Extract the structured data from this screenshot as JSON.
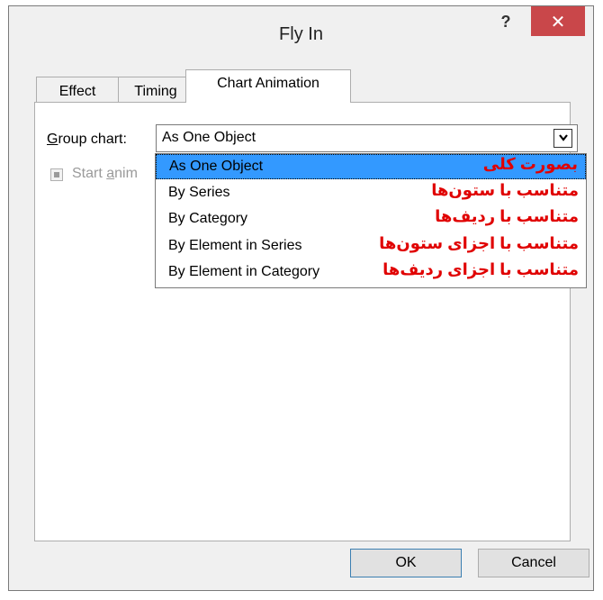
{
  "window": {
    "title": "Fly In",
    "help": "?",
    "close": "✕"
  },
  "tabs": [
    {
      "label": "Effect",
      "selected": false
    },
    {
      "label": "Timing",
      "selected": false
    },
    {
      "label": "Chart Animation",
      "selected": true
    }
  ],
  "group_chart": {
    "label_accel": "G",
    "label_rest": "roup chart:",
    "value": "As One Object",
    "arrow_icon": "chevron-down-icon"
  },
  "start_animation": {
    "label_start": "Start ",
    "label_accel": "a",
    "label_rest": "nim",
    "checked": true,
    "disabled": true
  },
  "dropdown": {
    "options": [
      {
        "label": "As One Object",
        "annotation": "بصورت کلی",
        "highlighted": true
      },
      {
        "label": "By Series",
        "annotation": "متناسب با ستون‌ها",
        "highlighted": false
      },
      {
        "label": "By Category",
        "annotation": "متناسب با ردیف‌ها",
        "highlighted": false
      },
      {
        "label": "By Element in Series",
        "annotation": "متناسب با اجزای ستون‌ها",
        "highlighted": false
      },
      {
        "label": "By Element in Category",
        "annotation": "متناسب با اجزای ردیف‌ها",
        "highlighted": false
      }
    ]
  },
  "buttons": {
    "ok": "OK",
    "cancel": "Cancel"
  },
  "colors": {
    "highlight": "#3399ff",
    "annotation": "#e00000",
    "close_button": "#c9474a",
    "dialog_bg": "#f0f0f0"
  }
}
